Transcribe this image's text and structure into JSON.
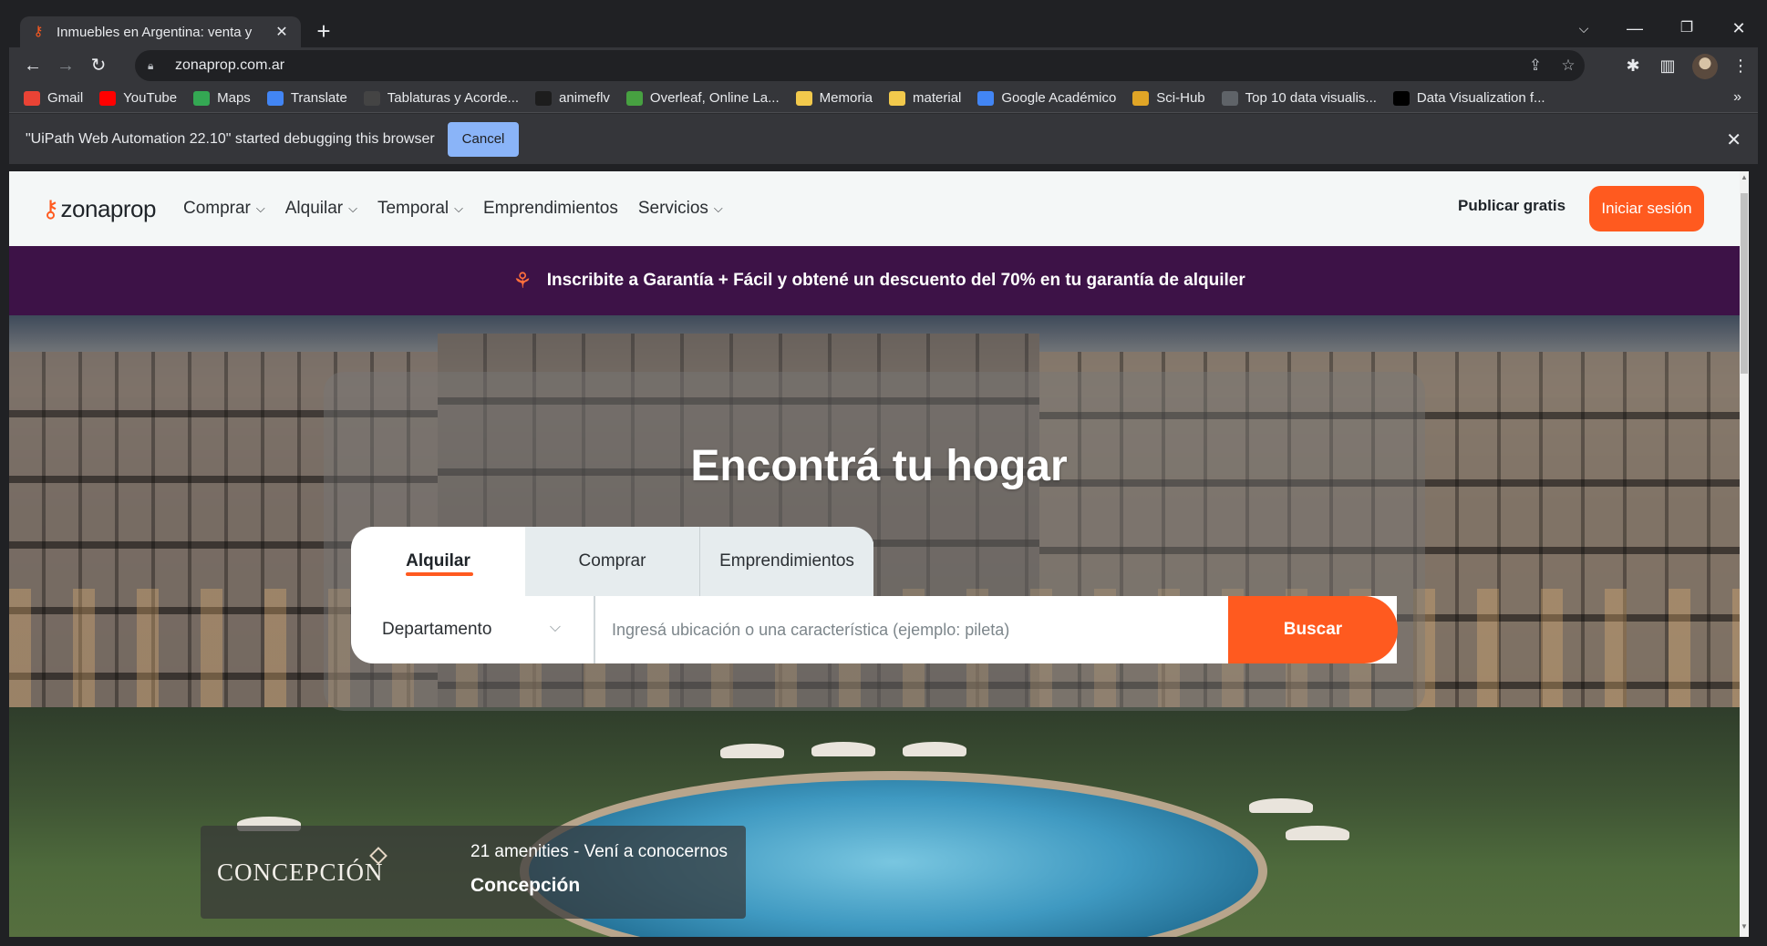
{
  "browser": {
    "tab_title": "Inmuebles en Argentina: venta y",
    "tab_favicon": "key-icon",
    "url": "zonaprop.com.ar",
    "bookmarks": [
      {
        "label": "Gmail",
        "icon": "gmail-icon",
        "color": "#ea4335"
      },
      {
        "label": "YouTube",
        "icon": "youtube-icon",
        "color": "#ff0000"
      },
      {
        "label": "Maps",
        "icon": "maps-icon",
        "color": "#34a853"
      },
      {
        "label": "Translate",
        "icon": "translate-icon",
        "color": "#4285f4"
      },
      {
        "label": "Tablaturas y Acorde...",
        "icon": "guitar-icon",
        "color": "#444444"
      },
      {
        "label": "animeflv",
        "icon": "animeflv-icon",
        "color": "#1d1d1d"
      },
      {
        "label": "Overleaf, Online La...",
        "icon": "overleaf-icon",
        "color": "#47a141"
      },
      {
        "label": "Memoria",
        "icon": "folder-icon",
        "color": "#f2c94c"
      },
      {
        "label": "material",
        "icon": "folder-icon",
        "color": "#f2c94c"
      },
      {
        "label": "Google Académico",
        "icon": "scholar-icon",
        "color": "#4285f4"
      },
      {
        "label": "Sci-Hub",
        "icon": "scihub-icon",
        "color": "#e0a526"
      },
      {
        "label": "Top 10 data visualis...",
        "icon": "globe-icon",
        "color": "#5f6368"
      },
      {
        "label": "Data Visualization f...",
        "icon": "notion-icon",
        "color": "#000000"
      }
    ],
    "infobar_text": "\"UiPath Web Automation 22.10\" started debugging this browser",
    "infobar_cancel": "Cancel"
  },
  "site": {
    "logo": "zonaprop",
    "nav": [
      {
        "label": "Comprar",
        "has_menu": true
      },
      {
        "label": "Alquilar",
        "has_menu": true
      },
      {
        "label": "Temporal",
        "has_menu": true
      },
      {
        "label": "Emprendimientos",
        "has_menu": false
      },
      {
        "label": "Servicios",
        "has_menu": true
      }
    ],
    "publish": "Publicar gratis",
    "login": "Iniciar sesión",
    "promo_banner": "Inscribite a Garantía + Fácil y obtené un descuento del 70% en tu garantía de alquiler",
    "accent": "#ff5a1f",
    "banner_color": "#3d1247"
  },
  "hero": {
    "title": "Encontrá tu hogar",
    "tabs": [
      "Alquilar",
      "Comprar",
      "Emprendimientos"
    ],
    "active_tab": "Alquilar",
    "property_type": "Departamento",
    "search_placeholder": "Ingresá ubicación o una característica (ejemplo: pileta)",
    "search_button": "Buscar",
    "card": {
      "brand": "CONCEPCIÓN",
      "subtitle": "21 amenities - Vení a conocernos",
      "name": "Concepción"
    }
  }
}
